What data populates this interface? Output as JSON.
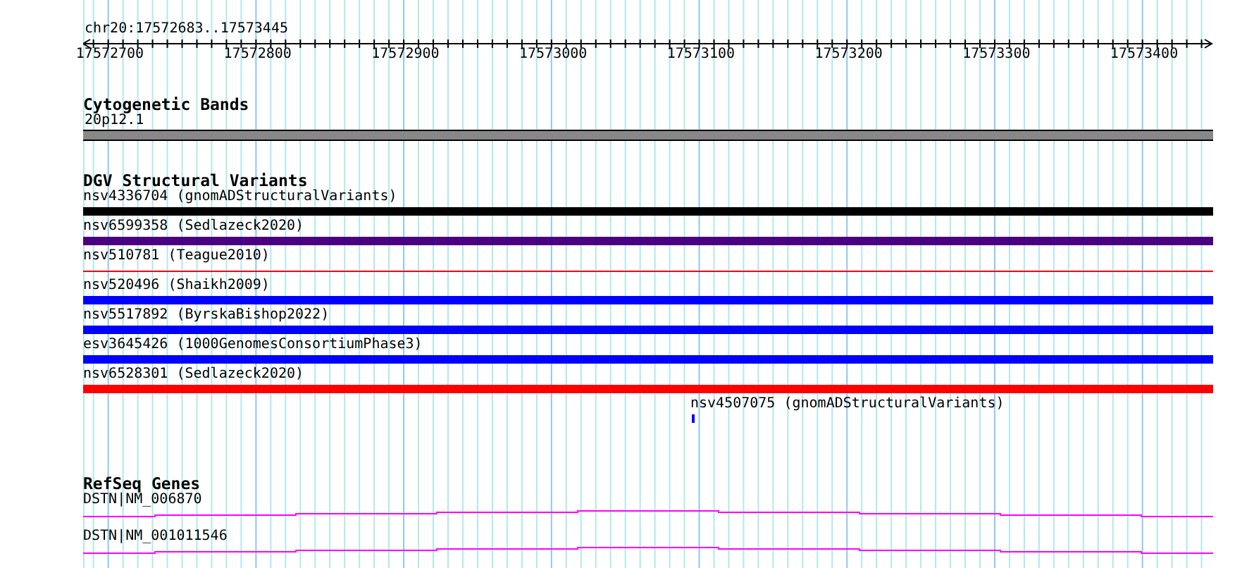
{
  "location": "chr20:17572683..17573445",
  "ruler": {
    "ticks": [
      "17572700",
      "17572800",
      "17572900",
      "17573000",
      "17573100",
      "17573200",
      "17573300",
      "17573400"
    ]
  },
  "cytogenetic_bands": {
    "title": "Cytogenetic Bands",
    "band": "20p12.1"
  },
  "dgv": {
    "title": "DGV Structural Variants",
    "variants": [
      {
        "label": "nsv4336704 (gnomADStructuralVariants)",
        "kind": "thick",
        "color": "#000000"
      },
      {
        "label": "nsv6599358 (Sedlazeck2020)",
        "kind": "thick",
        "color": "#4b0082"
      },
      {
        "label": "nsv510781 (Teague2010)",
        "kind": "thin",
        "color": "#ff0000"
      },
      {
        "label": "nsv520496 (Shaikh2009)",
        "kind": "thick",
        "color": "#0000ff"
      },
      {
        "label": "nsv5517892 (ByrskaBishop2022)",
        "kind": "thick",
        "color": "#0000ff"
      },
      {
        "label": "esv3645426 (1000GenomesConsortiumPhase3)",
        "kind": "thick",
        "color": "#0000ff"
      },
      {
        "label": "nsv6528301 (Sedlazeck2020)",
        "kind": "thick",
        "color": "#ff0000"
      },
      {
        "label": "nsv4507075 (gnomADStructuralVariants)",
        "kind": "point",
        "color": "#0000ff"
      }
    ]
  },
  "refseq": {
    "title": "RefSeq Genes",
    "genes": [
      {
        "label": "DSTN|NM_006870"
      },
      {
        "label": "DSTN|NM_001011546"
      }
    ]
  }
}
